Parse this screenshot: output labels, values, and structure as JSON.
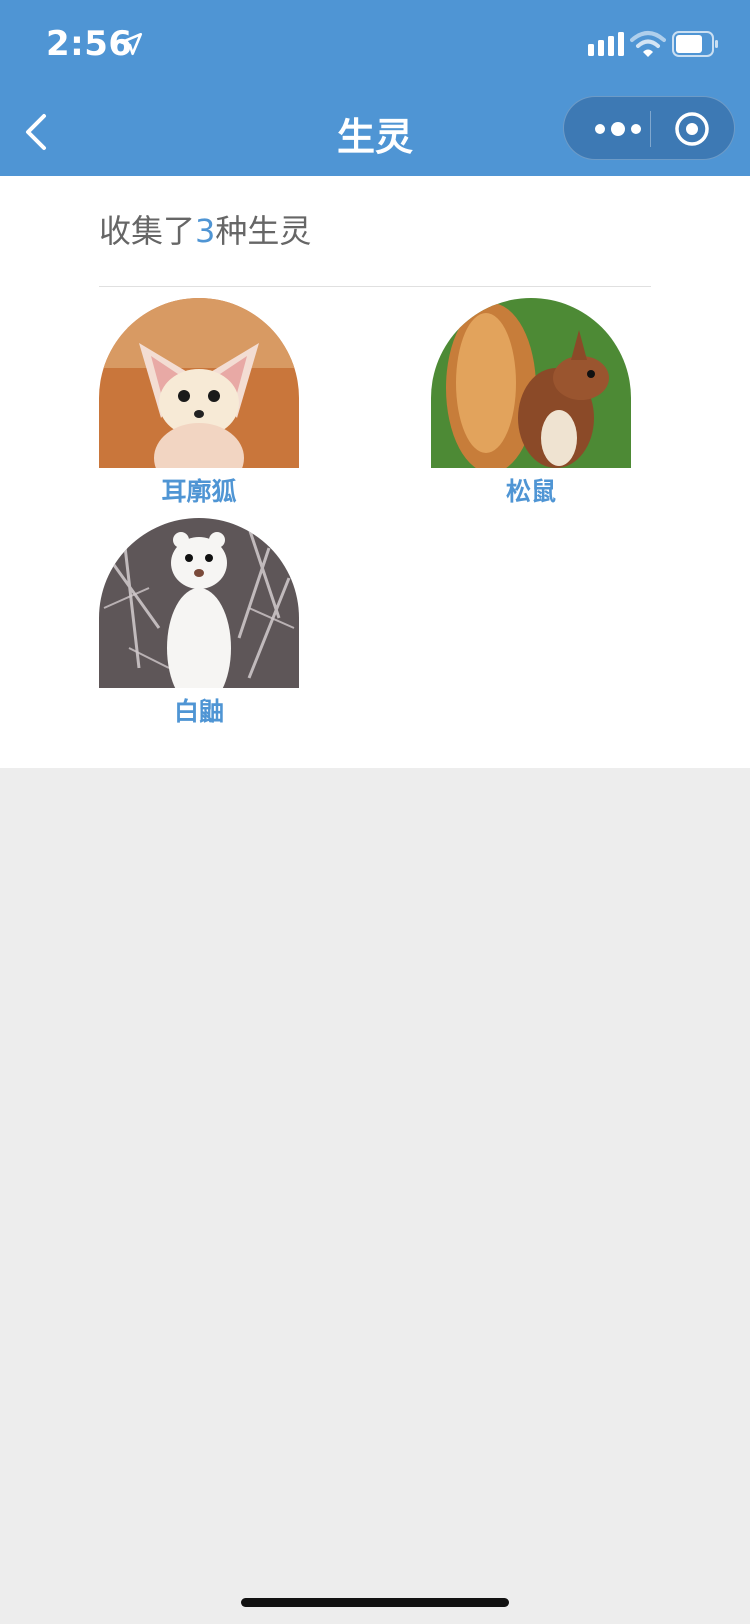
{
  "status_bar": {
    "time": "2:56"
  },
  "navbar": {
    "title": "生灵"
  },
  "summary": {
    "prefix": "收集了",
    "count": "3",
    "suffix": "种生灵"
  },
  "creatures": [
    {
      "name": "耳廓狐",
      "icon": "fennec-fox-photo"
    },
    {
      "name": "松鼠",
      "icon": "squirrel-photo"
    },
    {
      "name": "白鼬",
      "icon": "stoat-photo"
    }
  ],
  "colors": {
    "accent": "#4f95d4",
    "background": "#ededed"
  }
}
